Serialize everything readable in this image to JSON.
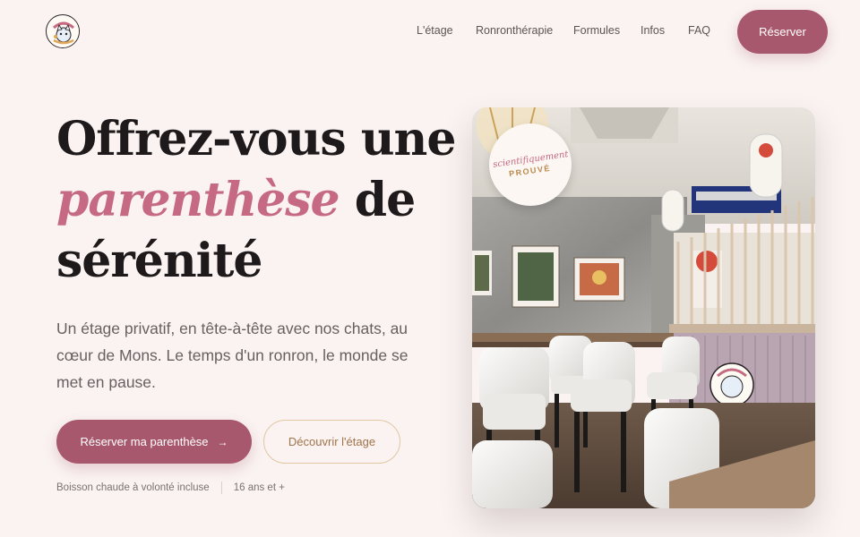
{
  "header": {
    "logo_icon": "cats-and-chill-logo",
    "nav": [
      {
        "label": "L'étage"
      },
      {
        "label": "Ronronthérapie"
      },
      {
        "label": "Formules"
      },
      {
        "label": "Infos"
      },
      {
        "label": "FAQ"
      }
    ],
    "cta_label": "Réserver"
  },
  "hero": {
    "title_line1": "Offrez-vous une",
    "title_accent": "parenthèse",
    "title_line2_rest": " de",
    "title_line3": "sérénité",
    "subtitle": "Un étage privatif, en tête-à-tête avec nos chats, au cœur de Mons. Le temps d'un ronron, le monde se met en pause.",
    "primary_button": "Réserver ma parenthèse",
    "primary_arrow": "→",
    "secondary_button": "Découvrir l'étage",
    "meta": [
      "Boisson chaude à volonté incluse",
      "16 ans et +"
    ]
  },
  "photo": {
    "badge_script": "scientifiquement",
    "badge_word": "PROUVÉ",
    "scene": "cat-cafe-interior-photo"
  },
  "colors": {
    "background": "#faf3f1",
    "accent": "#a8586d",
    "accent_light": "#c56a82",
    "gold": "#a0734a"
  }
}
